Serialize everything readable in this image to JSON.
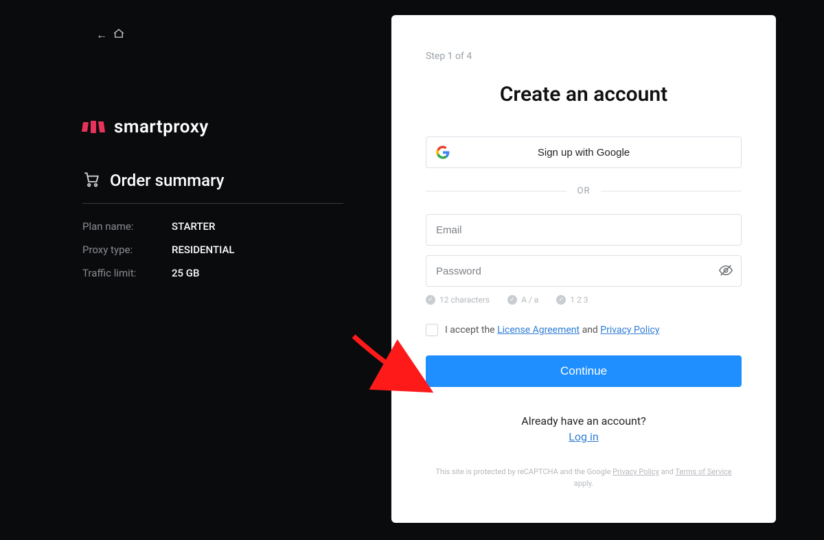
{
  "brand": "smartproxy",
  "order_summary": {
    "title": "Order summary",
    "rows": [
      {
        "label": "Plan name:",
        "value": "STARTER"
      },
      {
        "label": "Proxy type:",
        "value": "RESIDENTIAL"
      },
      {
        "label": "Traffic limit:",
        "value": "25 GB"
      }
    ]
  },
  "signup": {
    "step": "Step 1 of 4",
    "title": "Create an account",
    "google_label": "Sign up with Google",
    "or": "OR",
    "email_placeholder": "Email",
    "password_placeholder": "Password",
    "rules": [
      "12 characters",
      "A / a",
      "1 2 3"
    ],
    "accept_prefix": "I accept the ",
    "license_label": "License Agreement",
    "accept_mid": " and ",
    "privacy_label": "Privacy Policy",
    "continue_label": "Continue",
    "already": "Already have an account?",
    "login_label": "Log in",
    "legal_prefix": "This site is protected by reCAPTCHA and the Google ",
    "legal_privacy": "Privacy Policy",
    "legal_mid": " and ",
    "legal_tos": "Terms of Service",
    "legal_suffix": " apply."
  }
}
